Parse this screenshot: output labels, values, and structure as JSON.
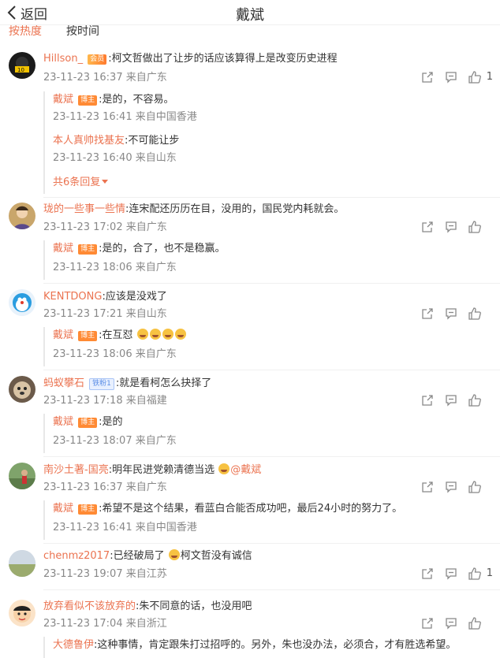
{
  "header": {
    "back_label": "返回",
    "title": "戴斌"
  },
  "sort": {
    "hot": "按热度",
    "time": "按时间"
  },
  "accent": "#eb7350",
  "comments": [
    {
      "user": "Hillson_",
      "badge": "会员",
      "text": ":柯文哲做出了让步的话应该算得上是改变历史进程",
      "time": "23-11-23 16:37 来自广东",
      "likes": "1",
      "replies": [
        {
          "user": "戴斌",
          "badge": "博主",
          "text": ":是的，不容易。",
          "time": "23-11-23 16:41 来自中国香港"
        },
        {
          "user": "本人真帅找基友",
          "text": ":不可能让步",
          "time": "23-11-23 16:40 来自山东"
        }
      ],
      "more": "共6条回复"
    },
    {
      "user": "珑的一些事一些情",
      "text": ":连宋配还历历在目，没用的，国民党内耗就会。",
      "time": "23-11-23 17:02 来自广东",
      "replies": [
        {
          "user": "戴斌",
          "badge": "博主",
          "text": ":是的，合了，也不是稳赢。",
          "time": "23-11-23 18:06 来自广东"
        }
      ]
    },
    {
      "user": "KENTDONG",
      "text": ":应该是没戏了",
      "time": "23-11-23 17:21 来自山东",
      "replies": [
        {
          "user": "戴斌",
          "badge": "博主",
          "text": ":在互怼",
          "time": "23-11-23 18:06 来自广东"
        }
      ]
    },
    {
      "user": "蚂蚁攀石",
      "badge": "铁粉1",
      "text": ":就是看柯怎么抉择了",
      "time": "23-11-23 17:18 来自福建",
      "replies": [
        {
          "user": "戴斌",
          "badge": "博主",
          "text": ":是的",
          "time": "23-11-23 18:07 来自广东"
        }
      ]
    },
    {
      "user": "南沙土著-国亮",
      "text": ":明年民进党赖清德当选",
      "mention": "@戴斌",
      "time": "23-11-23 16:37 来自广东",
      "replies": [
        {
          "user": "戴斌",
          "badge": "博主",
          "text": ":希望不是这个结果，看蓝白合能否成功吧，最后24小时的努力了。",
          "time": "23-11-23 16:41 来自中国香港"
        }
      ]
    },
    {
      "user": "chenmz2017",
      "text": ":已经破局了",
      "text2": "柯文哲没有诚信",
      "time": "23-11-23 19:07 来自江苏",
      "likes": "1"
    },
    {
      "user": "放弃看似不该放弃的",
      "text": ":朱不同意的话，也没用吧",
      "time": "23-11-23 17:04 来自浙江",
      "replies": [
        {
          "user": "大德鲁伊",
          "text": ":这种事情，肯定跟朱打过招呼的。另外，朱也没办法，必须合，才有胜选希望。"
        }
      ]
    }
  ]
}
